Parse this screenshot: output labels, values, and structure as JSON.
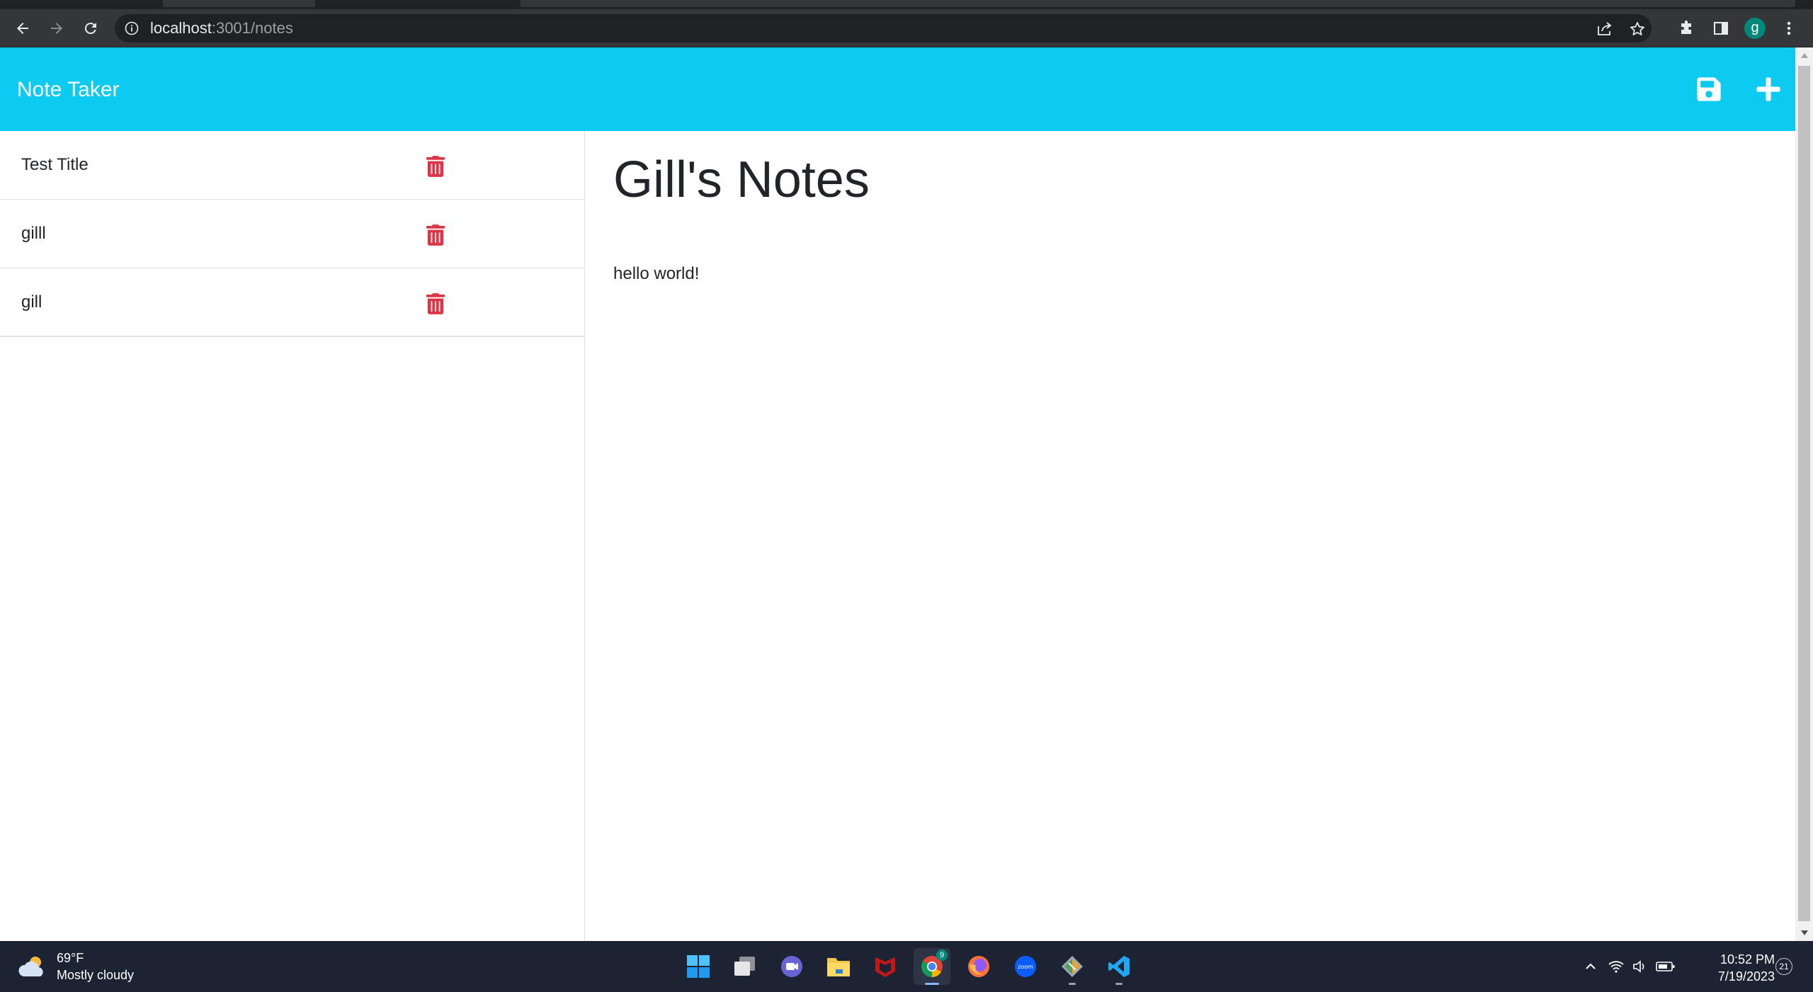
{
  "browser": {
    "url_host": "localhost",
    "url_path": ":3001/notes",
    "profile_initial": "g"
  },
  "app": {
    "brand": "Note Taker",
    "colors": {
      "navbar": "#0dcaf0",
      "delete": "#dc3545",
      "text": "#212529"
    }
  },
  "notes": [
    {
      "title": "Test Title"
    },
    {
      "title": "gilll"
    },
    {
      "title": "gill"
    }
  ],
  "active_note": {
    "title": "Gill's Notes",
    "text": "hello world!"
  },
  "taskbar": {
    "weather": {
      "temp": "69°F",
      "condition": "Mostly cloudy"
    },
    "chrome_badge": "9",
    "zoom_label": "zoom",
    "time": "10:52 PM",
    "date": "7/19/2023",
    "notification_count": "21"
  }
}
